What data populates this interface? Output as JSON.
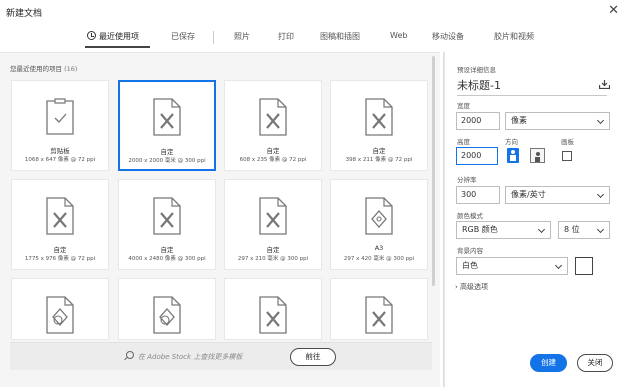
{
  "window": {
    "title": "新建文档",
    "close_glyph": "✕"
  },
  "tabs": [
    {
      "label": "最近使用项",
      "icon": "clock-icon",
      "active": true
    },
    {
      "label": "已保存"
    },
    {
      "label": "照片"
    },
    {
      "label": "打印"
    },
    {
      "label": "图稿和插图"
    },
    {
      "label": "Web"
    },
    {
      "label": "移动设备"
    },
    {
      "label": "胶片和视频"
    }
  ],
  "recent": {
    "heading": "您最近使用的项目",
    "count": "(16)",
    "presets": [
      {
        "name": "剪贴板",
        "size": "1068 x 647 像素 @ 72 ppi",
        "icon": "clipboard-icon"
      },
      {
        "name": "自定",
        "size": "2000 x 2000 毫米 @ 300 ppi",
        "icon": "custom-doc-icon",
        "selected": true
      },
      {
        "name": "自定",
        "size": "608 x 235 像素 @ 72 ppi",
        "icon": "custom-doc-icon"
      },
      {
        "name": "自定",
        "size": "398 x 211 像素 @ 72 ppi",
        "icon": "custom-doc-icon"
      },
      {
        "name": "自定",
        "size": "1775 x 976 像素 @ 72 ppi",
        "icon": "custom-doc-icon"
      },
      {
        "name": "自定",
        "size": "4000 x 2480 像素 @ 300 ppi",
        "icon": "custom-doc-icon"
      },
      {
        "name": "自定",
        "size": "297 x 210 毫米 @ 300 ppi",
        "icon": "custom-doc-icon"
      },
      {
        "name": "A3",
        "size": "297 x 420 毫米 @ 300 ppi",
        "icon": "print-doc-icon"
      },
      {
        "name": "",
        "size": "",
        "icon": "shapes-doc-icon"
      },
      {
        "name": "",
        "size": "",
        "icon": "shapes-doc-icon"
      },
      {
        "name": "",
        "size": "",
        "icon": "custom-doc-icon"
      },
      {
        "name": "",
        "size": "",
        "icon": "custom-doc-icon"
      }
    ]
  },
  "stock": {
    "placeholder": "在 Adobe Stock 上查找更多模板",
    "go_label": "前往"
  },
  "details": {
    "header": "预设详细信息",
    "doc_title": "未标题-1",
    "width_label": "宽度",
    "width_value": "2000",
    "width_unit": "像素",
    "height_label": "高度",
    "height_value": "2000",
    "orientation_label": "方向",
    "artboard_label": "画板",
    "resolution_label": "分辨率",
    "resolution_value": "300",
    "resolution_unit": "像素/英寸",
    "color_mode_label": "颜色模式",
    "color_mode_value": "RGB 颜色",
    "bit_depth_value": "8 位",
    "background_label": "背景内容",
    "background_value": "白色",
    "advanced_label": "高级选项"
  },
  "actions": {
    "create_label": "创建",
    "close_label": "关闭"
  },
  "colors": {
    "accent": "#1473e6",
    "panel_bg": "#f5f5f5",
    "swatch": "#ffffff"
  }
}
